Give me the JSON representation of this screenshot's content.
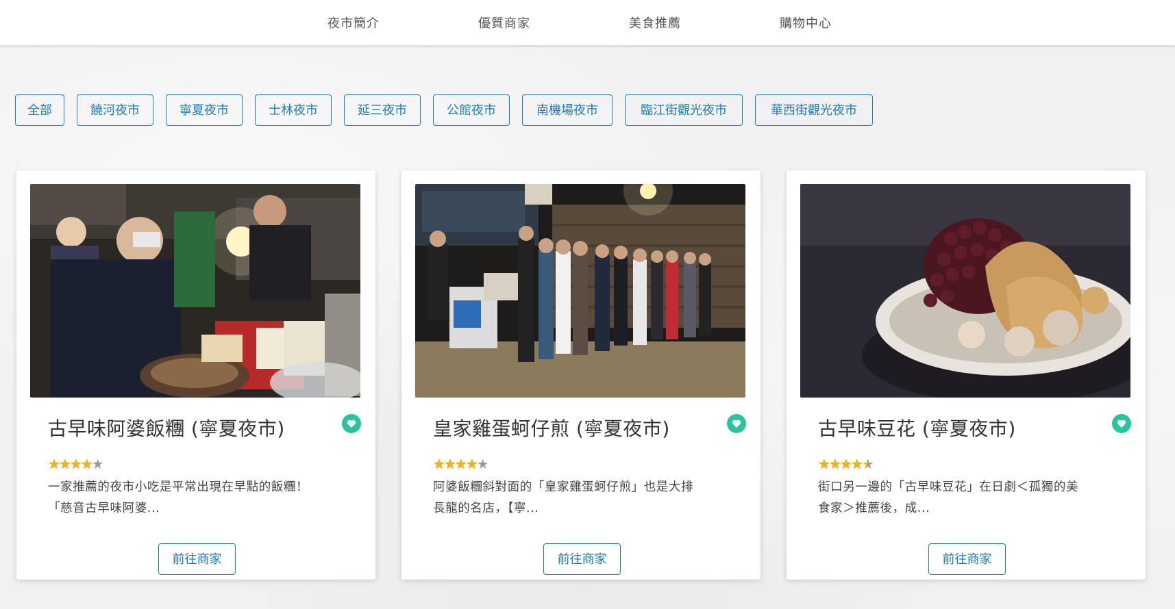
{
  "nav": {
    "items": [
      {
        "label": "夜市簡介"
      },
      {
        "label": "優質商家"
      },
      {
        "label": "美食推薦"
      },
      {
        "label": "購物中心"
      }
    ]
  },
  "filters": [
    {
      "label": "全部"
    },
    {
      "label": "饒河夜市"
    },
    {
      "label": "寧夏夜市"
    },
    {
      "label": "士林夜市"
    },
    {
      "label": "延三夜市"
    },
    {
      "label": "公館夜市"
    },
    {
      "label": "南機場夜市"
    },
    {
      "label": "臨江街觀光夜市"
    },
    {
      "label": "華西街觀光夜市"
    }
  ],
  "cards": [
    {
      "title": "古早味阿婆飯糰 (寧夏夜市)",
      "rating": 4,
      "desc_line1": "一家推薦的夜市小吃是平常出現在早點的飯糰！",
      "desc_line2": "「慈音古早味阿婆...",
      "button": "前往商家",
      "image_icon": "night-market-stall-photo"
    },
    {
      "title": "皇家雞蛋蚵仔煎 (寧夏夜市)",
      "rating": 4,
      "desc_line1": "阿婆飯糰斜對面的「皇家雞蛋蚵仔煎」也是大排",
      "desc_line2": "長龍的名店，【寧...",
      "button": "前往商家",
      "image_icon": "queue-line-photo"
    },
    {
      "title": "古早味豆花 (寧夏夜市)",
      "rating": 4.5,
      "desc_line1": "街口另一邊的「古早味豆花」在日劇＜孤獨的美",
      "desc_line2": "食家＞推薦後，成...",
      "button": "前往商家",
      "image_icon": "douhua-dessert-photo"
    }
  ],
  "colors": {
    "accent": "#1e7bbf",
    "heart": "#27c49d",
    "star": "#f2b01e"
  }
}
